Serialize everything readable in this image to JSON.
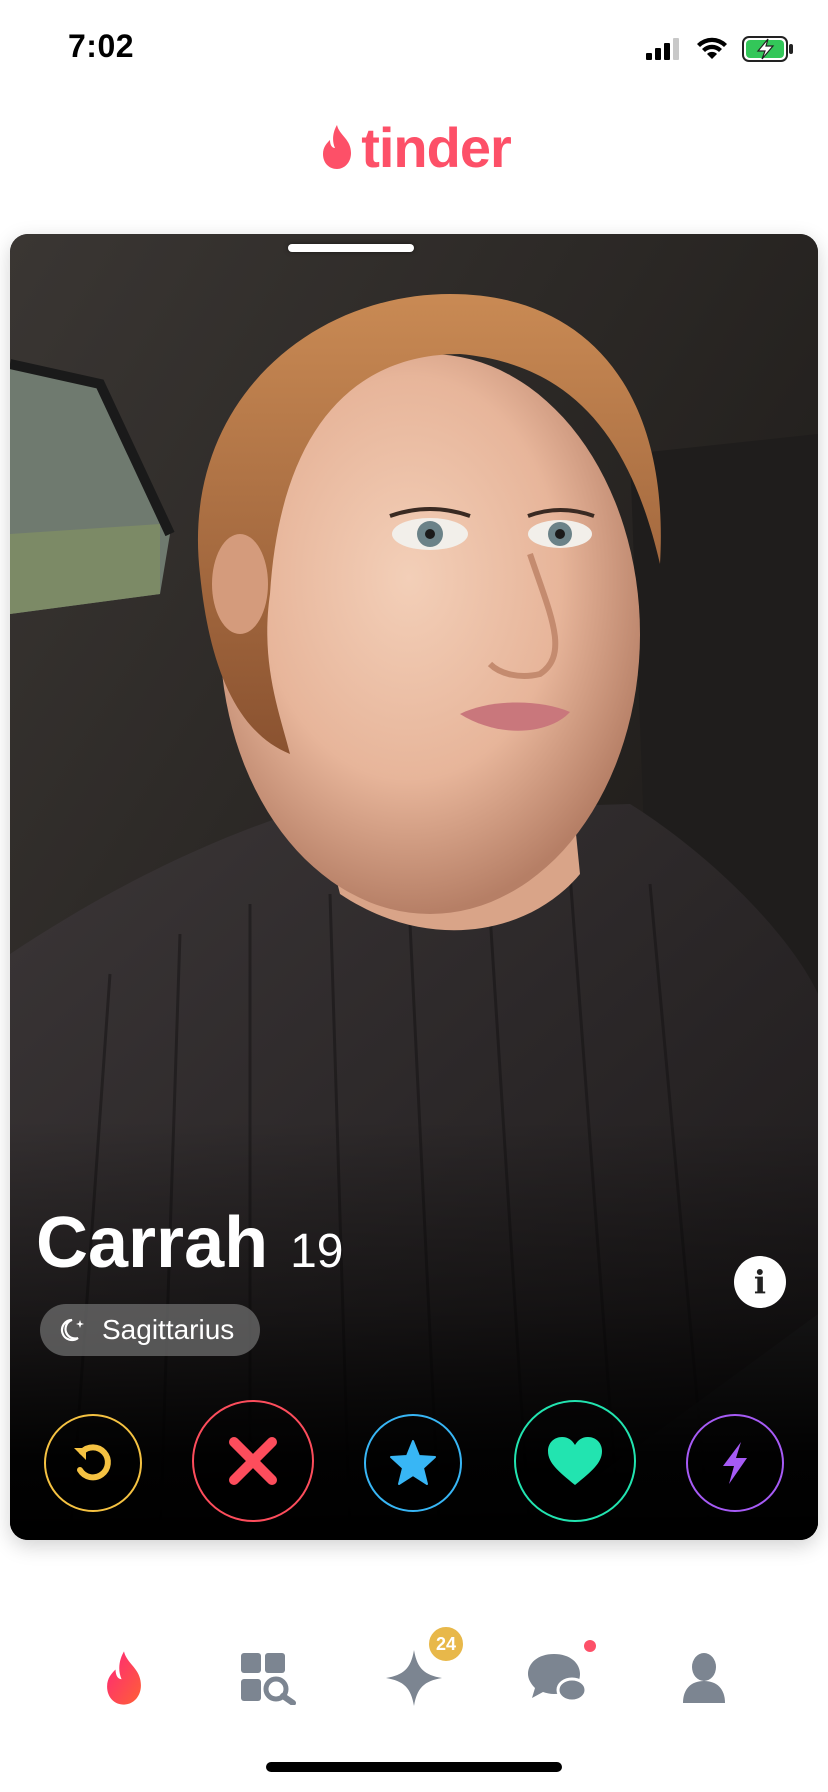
{
  "status_bar": {
    "time": "7:02",
    "signal_icon": "signal-icon",
    "wifi_icon": "wifi-icon",
    "battery_icon": "battery-charging-icon"
  },
  "header": {
    "logo_text": "tinder",
    "logo_icon": "flame-icon",
    "brand_color": "#fd5068"
  },
  "card": {
    "name": "Carrah",
    "age": "19",
    "zodiac": {
      "icon": "moon-stars-icon",
      "label": "Sagittarius"
    },
    "info_icon": "i",
    "photo_index": 1,
    "photo_count": 1
  },
  "actions": [
    {
      "name": "rewind",
      "icon": "rewind-icon",
      "color": "#f5c242"
    },
    {
      "name": "nope",
      "icon": "x-icon",
      "color": "#fd4d5c"
    },
    {
      "name": "super-like",
      "icon": "star-icon",
      "color": "#38b6f5"
    },
    {
      "name": "like",
      "icon": "heart-icon",
      "color": "#22e4b0"
    },
    {
      "name": "boost",
      "icon": "bolt-icon",
      "color": "#a65bf5"
    }
  ],
  "nav": {
    "items": [
      "flame-icon",
      "explore-icon",
      "sparkle-icon",
      "chat-icon",
      "profile-icon"
    ],
    "active": "flame-icon",
    "sparkle_badge": "24",
    "chat_has_notification": true
  }
}
